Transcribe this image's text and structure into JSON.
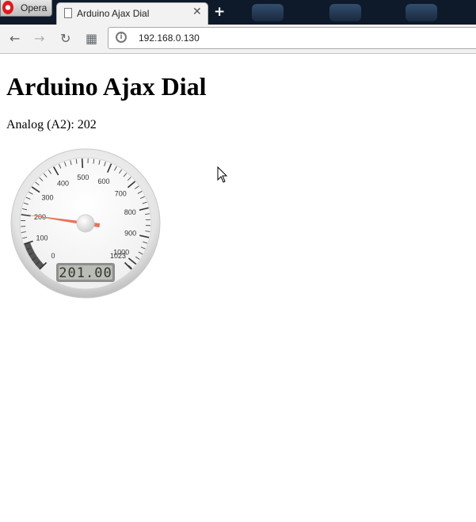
{
  "browser": {
    "menu_label": "Opera",
    "tab_title": "Arduino Ajax Dial",
    "close_glyph": "✕",
    "new_tab_glyph": "+",
    "back_glyph": "←",
    "forward_glyph": "→",
    "reload_glyph": "↻",
    "apps_glyph": "▦",
    "address": "192.168.0.130"
  },
  "page": {
    "heading": "Arduino Ajax Dial",
    "analog_text": "Analog (A2): 202"
  },
  "gauge": {
    "min": 0,
    "max": 1023,
    "value": 202,
    "readout": "201.00",
    "tick_labels": [
      "0",
      "100",
      "200",
      "300",
      "400",
      "500",
      "600",
      "700",
      "800",
      "900",
      "1000",
      "1023"
    ],
    "colors": {
      "needle": "#e8735e",
      "readout_bg": "#b9bdb4",
      "readout_text": "#333333"
    }
  }
}
